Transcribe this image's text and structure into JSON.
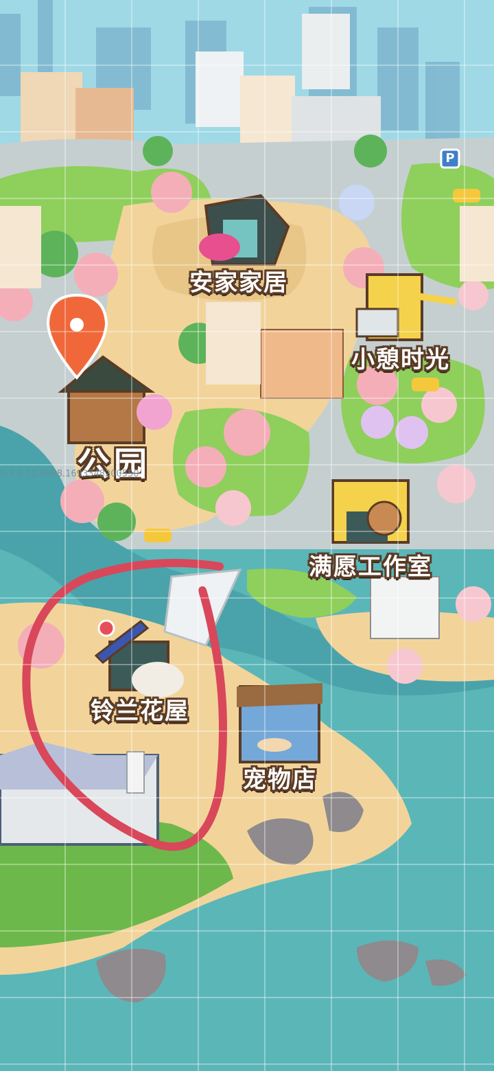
{
  "map": {
    "locations": {
      "furniture": {
        "label": "安家家居"
      },
      "cafe": {
        "label": "小憩时光"
      },
      "park": {
        "label": "公园"
      },
      "studio": {
        "label": "满愿工作室"
      },
      "flower_shop": {
        "label": "铃兰花屋"
      },
      "pet_shop": {
        "label": "宠物店"
      }
    },
    "parking_sign": "P",
    "version_text": "0.3.0.12.8088.1693348200550"
  },
  "colors": {
    "sea": "#5bb6b8",
    "sand": "#f2d49b",
    "grass": "#8fcf5c",
    "road": "#b9c3c5",
    "label_outline": "#5a3b26",
    "pin": "#f0683a",
    "annotation_circle": "#d9475a"
  }
}
